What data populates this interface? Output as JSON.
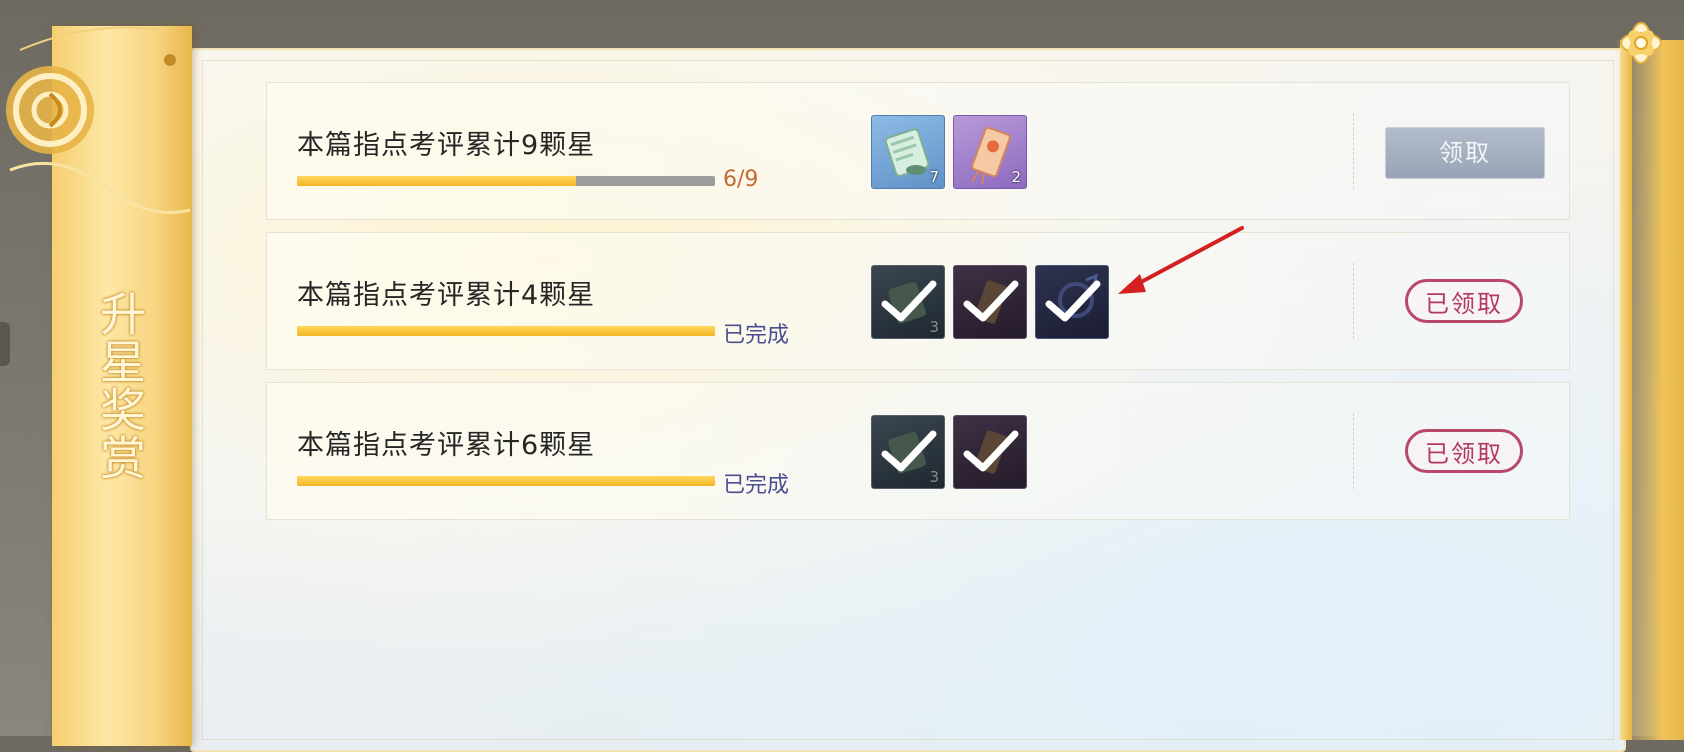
{
  "sidebar": {
    "title": "升星奖赏"
  },
  "rows": [
    {
      "title": "本篇指点考评累计9颗星",
      "progress": 0.667,
      "progress_text": "6/9",
      "items": [
        {
          "icon": "scroll-item-icon",
          "qty": "7",
          "style": "blue"
        },
        {
          "icon": "charm-item-icon",
          "qty": "2",
          "style": "purple"
        }
      ],
      "action": "领取",
      "state": "claimable"
    },
    {
      "title": "本篇指点考评累计4颗星",
      "progress": 1.0,
      "progress_text": "已完成",
      "items": [
        {
          "icon": "scroll-item-icon",
          "qty": "3",
          "style": "dark1"
        },
        {
          "icon": "charm-item-icon",
          "qty": "",
          "style": "dark2"
        },
        {
          "icon": "avatar-frame-item-icon",
          "qty": "",
          "style": "dark3"
        }
      ],
      "action": "已领取",
      "state": "claimed"
    },
    {
      "title": "本篇指点考评累计6颗星",
      "progress": 1.0,
      "progress_text": "已完成",
      "items": [
        {
          "icon": "scroll-item-icon",
          "qty": "3",
          "style": "dark1"
        },
        {
          "icon": "charm-item-icon",
          "qty": "",
          "style": "dark2"
        }
      ],
      "action": "已领取",
      "state": "claimed"
    }
  ],
  "colors": {
    "progress_fill": "#f3b523",
    "progress_track": "#9d9d9b",
    "stamp": "#b23a60",
    "button": "#98a4b6",
    "annotation_arrow": "#d42020"
  }
}
